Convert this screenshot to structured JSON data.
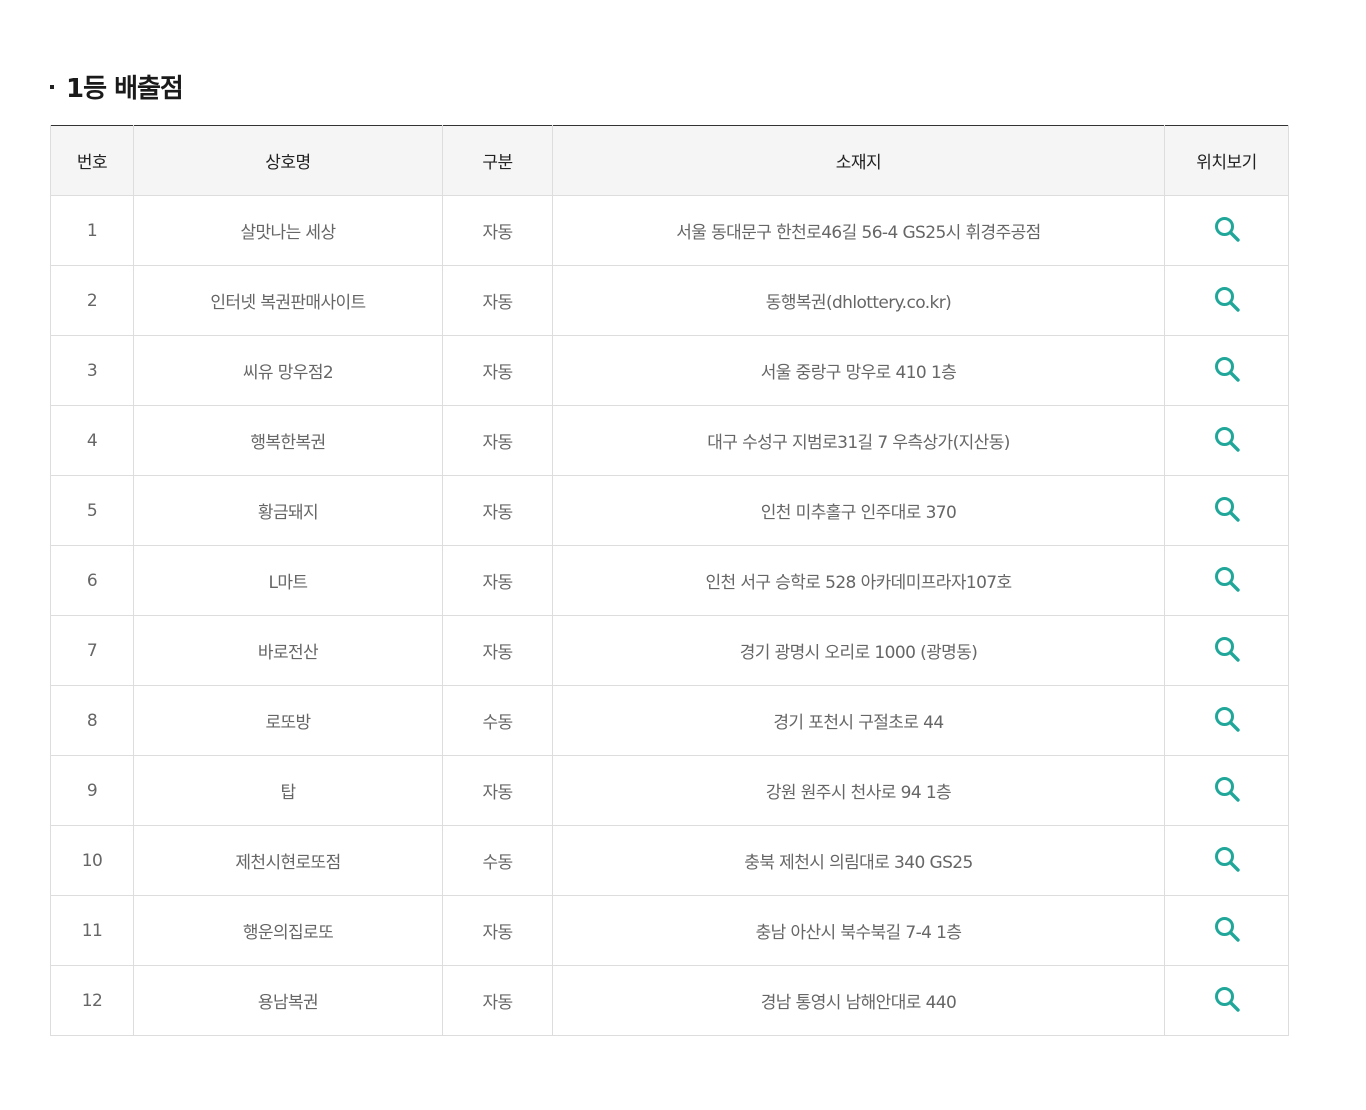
{
  "section": {
    "title": "1등 배출점"
  },
  "table": {
    "headers": {
      "number": "번호",
      "store_name": "상호명",
      "type": "구분",
      "address": "소재지",
      "location": "위치보기"
    },
    "rows": [
      {
        "number": "1",
        "store_name": "살맛나는 세상",
        "type": "자동",
        "address": "서울 동대문구 한천로46길 56-4 GS25시 휘경주공점"
      },
      {
        "number": "2",
        "store_name": "인터넷 복권판매사이트",
        "type": "자동",
        "address": "동행복권(dhlottery.co.kr)"
      },
      {
        "number": "3",
        "store_name": "씨유 망우점2",
        "type": "자동",
        "address": "서울 중랑구 망우로 410 1층"
      },
      {
        "number": "4",
        "store_name": "행복한복권",
        "type": "자동",
        "address": "대구 수성구 지범로31길 7 우측상가(지산동)"
      },
      {
        "number": "5",
        "store_name": "황금돼지",
        "type": "자동",
        "address": "인천 미추홀구 인주대로 370"
      },
      {
        "number": "6",
        "store_name": "L마트",
        "type": "자동",
        "address": "인천 서구 승학로 528 아카데미프라자107호"
      },
      {
        "number": "7",
        "store_name": "바로전산",
        "type": "자동",
        "address": "경기 광명시 오리로 1000 (광명동)"
      },
      {
        "number": "8",
        "store_name": "로또방",
        "type": "수동",
        "address": "경기 포천시 구절초로 44"
      },
      {
        "number": "9",
        "store_name": "탑",
        "type": "자동",
        "address": "강원 원주시 천사로 94 1층"
      },
      {
        "number": "10",
        "store_name": "제천시현로또점",
        "type": "수동",
        "address": "충북 제천시 의림대로 340 GS25"
      },
      {
        "number": "11",
        "store_name": "행운의집로또",
        "type": "자동",
        "address": "충남 아산시 북수북길 7-4 1층"
      },
      {
        "number": "12",
        "store_name": "용남복권",
        "type": "자동",
        "address": "경남 통영시 남해안대로 440"
      }
    ]
  },
  "icons": {
    "location": "search-icon"
  },
  "colors": {
    "icon_accent": "#20a79a",
    "header_bg": "#f5f5f5",
    "border": "#dddddd",
    "top_border": "#333333"
  }
}
